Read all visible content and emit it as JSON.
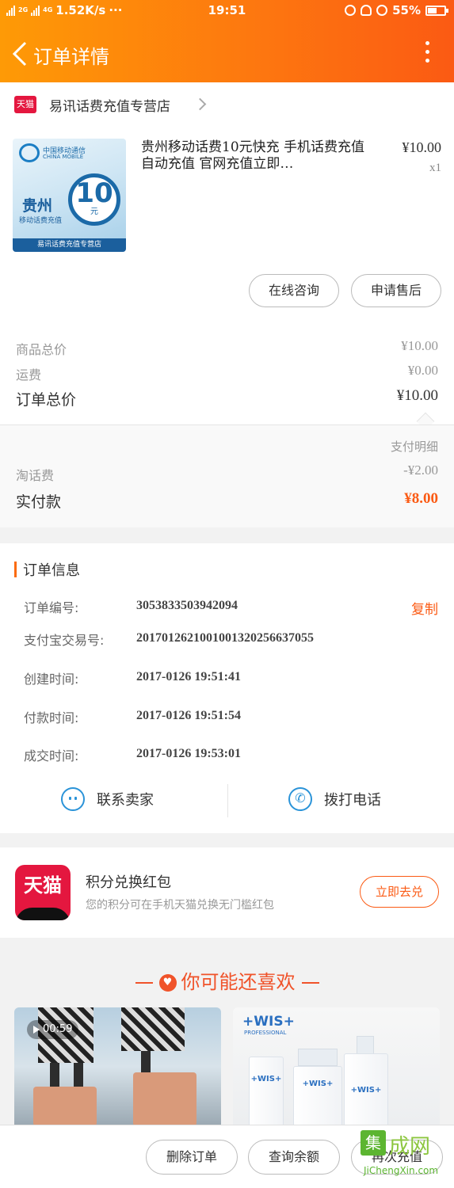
{
  "status_bar": {
    "network_speed": "1.52K/s",
    "dots": "···",
    "time": "19:51",
    "battery": "55%",
    "battery_level": 0.55,
    "net_label_top": "4G",
    "net_label_bottom": "2G"
  },
  "nav": {
    "title": "订单详情"
  },
  "shop": {
    "badge": "天猫",
    "name": "易讯话费充值专营店"
  },
  "product": {
    "image": {
      "brand_cn": "中国移动通信",
      "brand_en": "CHINA MOBILE",
      "region": "贵州",
      "region_sub": "移动话费充值",
      "amount": "10",
      "amount_unit": "元",
      "footer": "易讯话费充值专营店"
    },
    "title": "贵州移动话费10元快充 手机话费充值 自动充值 官网充值立即…",
    "price": "¥10.00",
    "qty": "x1",
    "consult_button": "在线咨询",
    "aftersale_button": "申请售后"
  },
  "costs": {
    "goods_label": "商品总价",
    "goods_value": "¥10.00",
    "shipping_label": "运费",
    "shipping_value": "¥0.00",
    "total_label": "订单总价",
    "total_value": "¥10.00"
  },
  "payment": {
    "detail_link": "支付明细",
    "fee_label": "淘话费",
    "fee_value": "-¥2.00",
    "paid_label": "实付款",
    "paid_value": "¥8.00"
  },
  "order_info": {
    "title": "订单信息",
    "copy_label": "复制",
    "rows": [
      {
        "label": "订单编号:",
        "value": "3053833503942094"
      },
      {
        "label": "支付宝交易号:",
        "value": "2017012621001001320256637055"
      },
      {
        "label": "创建时间:",
        "value": "2017-0126 19:51:41"
      },
      {
        "label": "付款时间:",
        "value": "2017-0126 19:51:54"
      },
      {
        "label": "成交时间:",
        "value": "2017-0126 19:53:01"
      }
    ],
    "contact_seller": "联系卖家",
    "call_phone": "拨打电话"
  },
  "promo": {
    "logo_text": "天猫",
    "title": "积分兑换红包",
    "subtitle": "您的积分可在手机天猫兑换无门槛红包",
    "button": "立即去兑"
  },
  "recommend": {
    "title": "你可能还喜欢",
    "video_duration": "00:59",
    "wis_logo": "+WIS+",
    "wis_sub": "PROFESSIONAL",
    "bottle_label": "+WIS+"
  },
  "bottom_bar": {
    "delete_order": "删除订单",
    "check_balance": "查询余额",
    "recharge_again": "再次充值"
  },
  "watermark": {
    "box_char": "集",
    "cn": "成网",
    "en": "JiChengXin.com"
  }
}
